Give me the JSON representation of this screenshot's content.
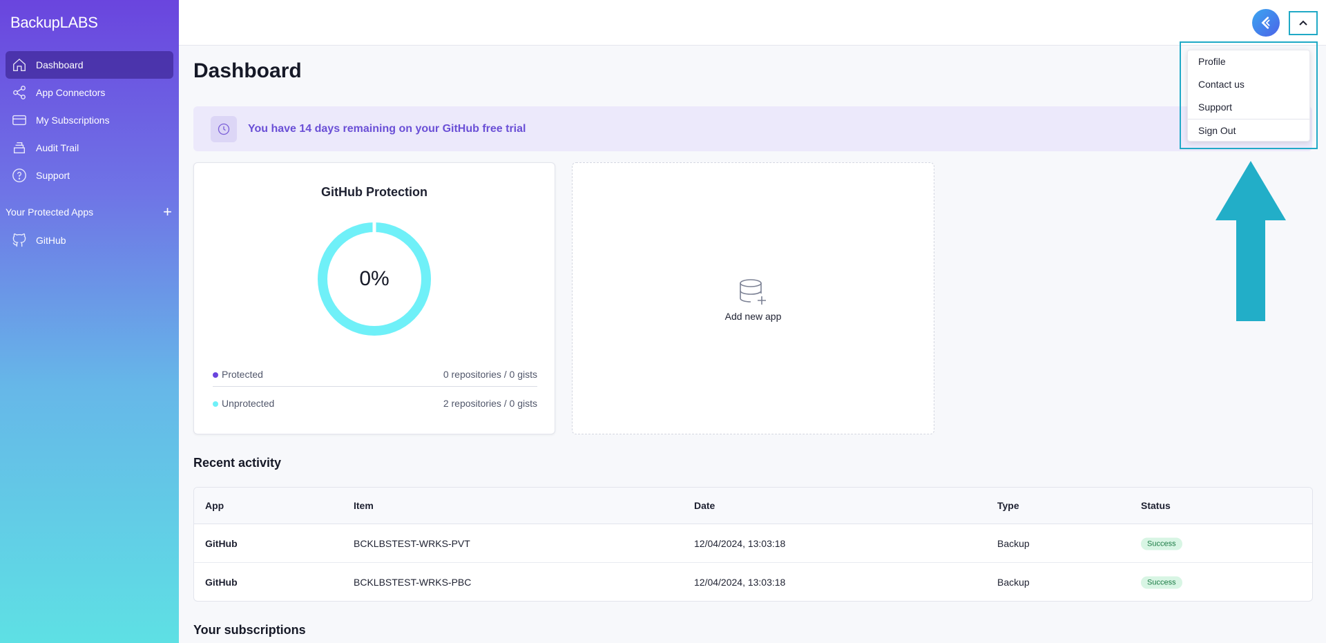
{
  "brand": {
    "part1": "Backup",
    "part2": "LABS"
  },
  "sidebar": {
    "items": [
      {
        "label": "Dashboard",
        "icon": "home-icon",
        "active": true
      },
      {
        "label": "App Connectors",
        "icon": "share-icon"
      },
      {
        "label": "My Subscriptions",
        "icon": "credit-card-icon"
      },
      {
        "label": "Audit Trail",
        "icon": "archive-icon"
      },
      {
        "label": "Support",
        "icon": "help-circle-icon"
      }
    ],
    "apps_heading": "Your Protected Apps",
    "apps": [
      {
        "label": "GitHub",
        "icon": "github-icon"
      }
    ]
  },
  "header": {
    "avatar_icon": "share-logo-icon",
    "menu_toggle_icon": "chevron-up-icon"
  },
  "user_menu": {
    "items": [
      "Profile",
      "Contact us",
      "Support"
    ],
    "sign_out": "Sign Out"
  },
  "page": {
    "title": "Dashboard"
  },
  "banner": {
    "text": "You have 14 days remaining on your GitHub free trial",
    "icon": "clock-icon"
  },
  "protection_card": {
    "title": "GitHub Protection",
    "percent_label": "0%",
    "protected_fraction": 0,
    "colors": {
      "protected": "#6a45de",
      "unprotected": "#6ff0f8"
    },
    "legend": [
      {
        "label": "Protected",
        "value": "0 repositories / 0 gists"
      },
      {
        "label": "Unprotected",
        "value": "2 repositories / 0 gists"
      }
    ]
  },
  "add_app": {
    "label": "Add new app",
    "icon": "database-plus-icon"
  },
  "recent_activity": {
    "title": "Recent activity",
    "columns": [
      "App",
      "Item",
      "Date",
      "Type",
      "Status"
    ],
    "rows": [
      {
        "app": "GitHub",
        "item": "BCKLBSTEST-WRKS-PVT",
        "date": "12/04/2024, 13:03:18",
        "type": "Backup",
        "status": "Success"
      },
      {
        "app": "GitHub",
        "item": "BCKLBSTEST-WRKS-PBC",
        "date": "12/04/2024, 13:03:18",
        "type": "Backup",
        "status": "Success"
      }
    ]
  },
  "subscriptions": {
    "title": "Your subscriptions"
  },
  "colors": {
    "accent": "#6a45de",
    "highlight": "#1fa9c6",
    "arrow": "#22aec8"
  }
}
